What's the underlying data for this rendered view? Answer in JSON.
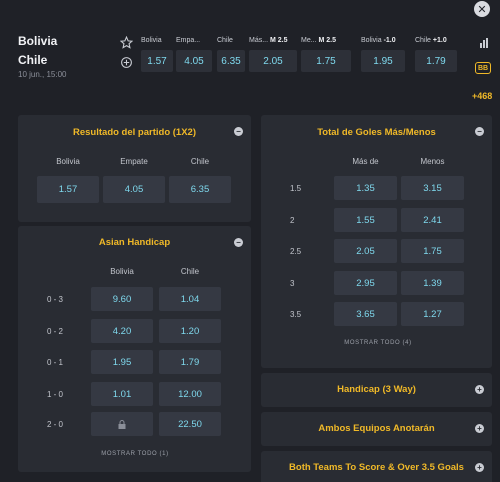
{
  "match": {
    "home": "Bolivia",
    "away": "Chile",
    "date": "10 jun., 15:00"
  },
  "header_markets": [
    {
      "label": "Bolivia",
      "bold": "",
      "value": "1.57"
    },
    {
      "label": "Empa...",
      "bold": "",
      "value": "4.05"
    },
    {
      "label": "Chile",
      "bold": "",
      "value": "6.35"
    },
    {
      "label": "Más...",
      "bold": "M 2.5",
      "value": "2.05"
    },
    {
      "label": "Me...",
      "bold": "M 2.5",
      "value": "1.75"
    },
    {
      "label": "Bolivia",
      "bold": "-1.0",
      "value": "1.95"
    },
    {
      "label": "Chile",
      "bold": "+1.0",
      "value": "1.79"
    }
  ],
  "header_extra": {
    "bb_label": "BB",
    "more_count": "+468",
    "close_glyph": "✕"
  },
  "result_panel": {
    "title": "Resultado del partido (1X2)",
    "toggle": "−",
    "cols": [
      "Bolivia",
      "Empate",
      "Chile"
    ],
    "odds": [
      "1.57",
      "4.05",
      "6.35"
    ]
  },
  "asian_panel": {
    "title": "Asian Handicap",
    "toggle": "−",
    "cols": [
      "Bolivia",
      "Chile"
    ],
    "rows": [
      {
        "label": "0 - 3",
        "a": "9.60",
        "b": "1.04"
      },
      {
        "label": "0 - 2",
        "a": "4.20",
        "b": "1.20"
      },
      {
        "label": "0 - 1",
        "a": "1.95",
        "b": "1.79"
      },
      {
        "label": "1 - 0",
        "a": "1.01",
        "b": "12.00"
      },
      {
        "label": "2 - 0",
        "a": "",
        "b": "22.50"
      }
    ],
    "show_all": "MOSTRAR TODO (1)"
  },
  "totals_panel": {
    "title": "Total de Goles Más/Menos",
    "toggle": "−",
    "cols": [
      "Más de",
      "Menos"
    ],
    "rows": [
      {
        "label": "1.5",
        "a": "1.35",
        "b": "3.15"
      },
      {
        "label": "2",
        "a": "1.55",
        "b": "2.41"
      },
      {
        "label": "2.5",
        "a": "2.05",
        "b": "1.75"
      },
      {
        "label": "3",
        "a": "2.95",
        "b": "1.39"
      },
      {
        "label": "3.5",
        "a": "3.65",
        "b": "1.27"
      }
    ],
    "show_all": "MOSTRAR TODO (4)"
  },
  "collapsed_panels": [
    {
      "title": "Handicap (3 Way)",
      "toggle": "+"
    },
    {
      "title": "Ambos Equipos Anotarán",
      "toggle": "+"
    },
    {
      "title": "Both Teams To Score & Over 3.5 Goals",
      "toggle": "+"
    }
  ]
}
